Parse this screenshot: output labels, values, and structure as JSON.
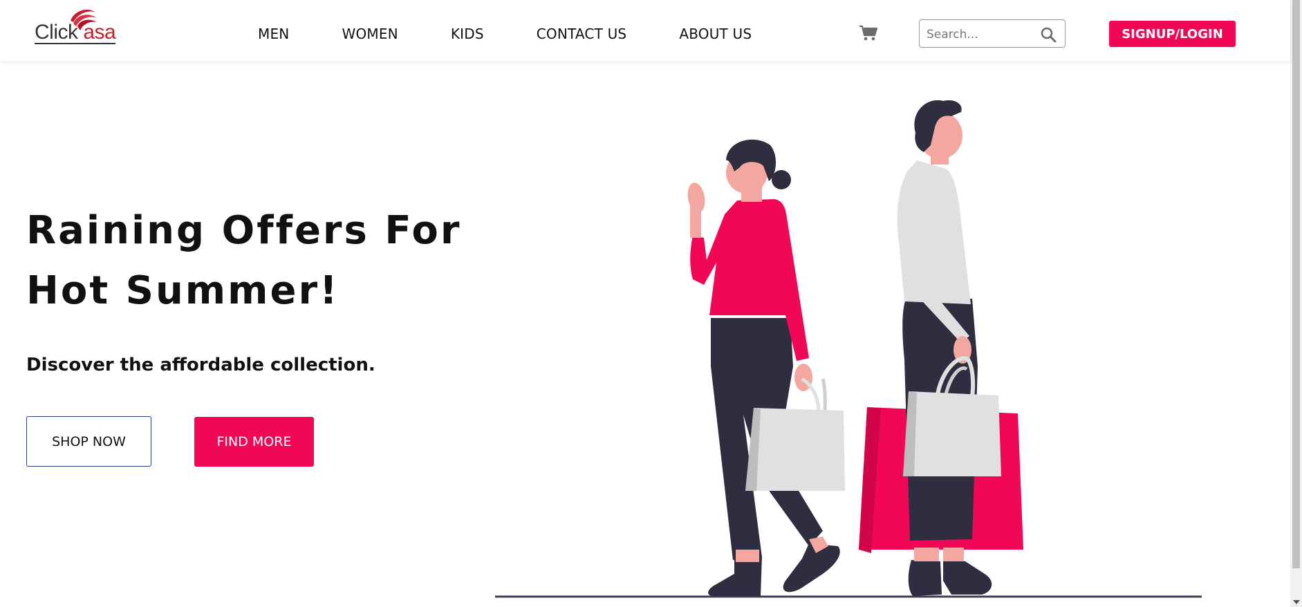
{
  "brand": {
    "logo_text_main": "Click",
    "logo_text_tail": "asa",
    "brand_color": "#c4202e"
  },
  "nav": {
    "items": [
      {
        "label": "MEN"
      },
      {
        "label": "WOMEN"
      },
      {
        "label": "KIDS"
      },
      {
        "label": "CONTACT US"
      },
      {
        "label": "ABOUT US"
      }
    ]
  },
  "header": {
    "cart_icon": "cart-icon",
    "search_placeholder": "Search...",
    "search_icon": "search-icon",
    "signup_label": "SIGNUP/LOGIN"
  },
  "hero": {
    "title_line1": "Raining Offers For",
    "title_line2": "Hot Summer!",
    "subtitle": "Discover the affordable collection.",
    "shop_now_label": "SHOP NOW",
    "find_more_label": "FIND MORE",
    "illustration": "shoppers-illustration"
  },
  "colors": {
    "accent": "#f20656",
    "outline_border": "#2c3b8f",
    "dark": "#2f2e41",
    "skin": "#f4a7a1",
    "light_grey": "#e0e0e0"
  }
}
